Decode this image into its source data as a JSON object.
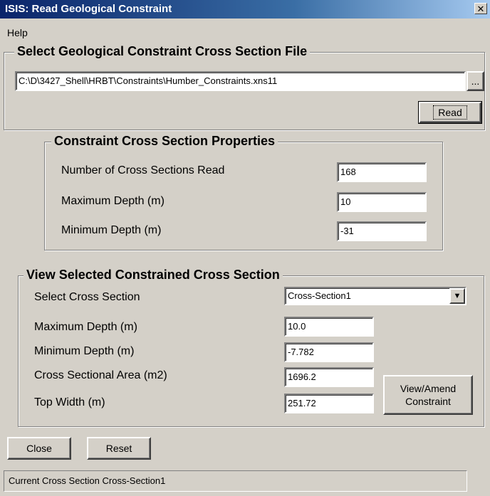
{
  "window": {
    "title": "ISIS: Read Geological Constraint",
    "close_glyph": "✕"
  },
  "menu": {
    "help": "Help"
  },
  "file_group": {
    "title": "Select Geological Constraint Cross Section File",
    "path": "C:\\D\\3427_Shell\\HRBT\\Constraints\\Humber_Constraints.xns11",
    "browse_label": "...",
    "read_label": "Read"
  },
  "properties": {
    "title": "Constraint Cross Section Properties",
    "num_read_label": "Number of Cross Sections Read",
    "num_read_value": "168",
    "max_depth_label": "Maximum Depth (m)",
    "max_depth_value": "10",
    "min_depth_label": "Minimum Depth (m)",
    "min_depth_value": "-31"
  },
  "view_selected": {
    "title": "View Selected Constrained Cross Section",
    "select_label": "Select Cross Section",
    "select_value": "Cross-Section1",
    "select_arrow": "▼",
    "max_depth_label": "Maximum Depth (m)",
    "max_depth_value": "10.0",
    "min_depth_label": "Minimum Depth (m)",
    "min_depth_value": "-7.782",
    "area_label": "Cross Sectional Area (m2)",
    "area_value": "1696.2",
    "top_width_label": "Top Width (m)",
    "top_width_value": "251.72",
    "view_amend_line1": "View/Amend",
    "view_amend_line2": "Constraint"
  },
  "footer": {
    "close_label": "Close",
    "reset_label": "Reset",
    "status_text": "Current Cross Section Cross-Section1"
  }
}
